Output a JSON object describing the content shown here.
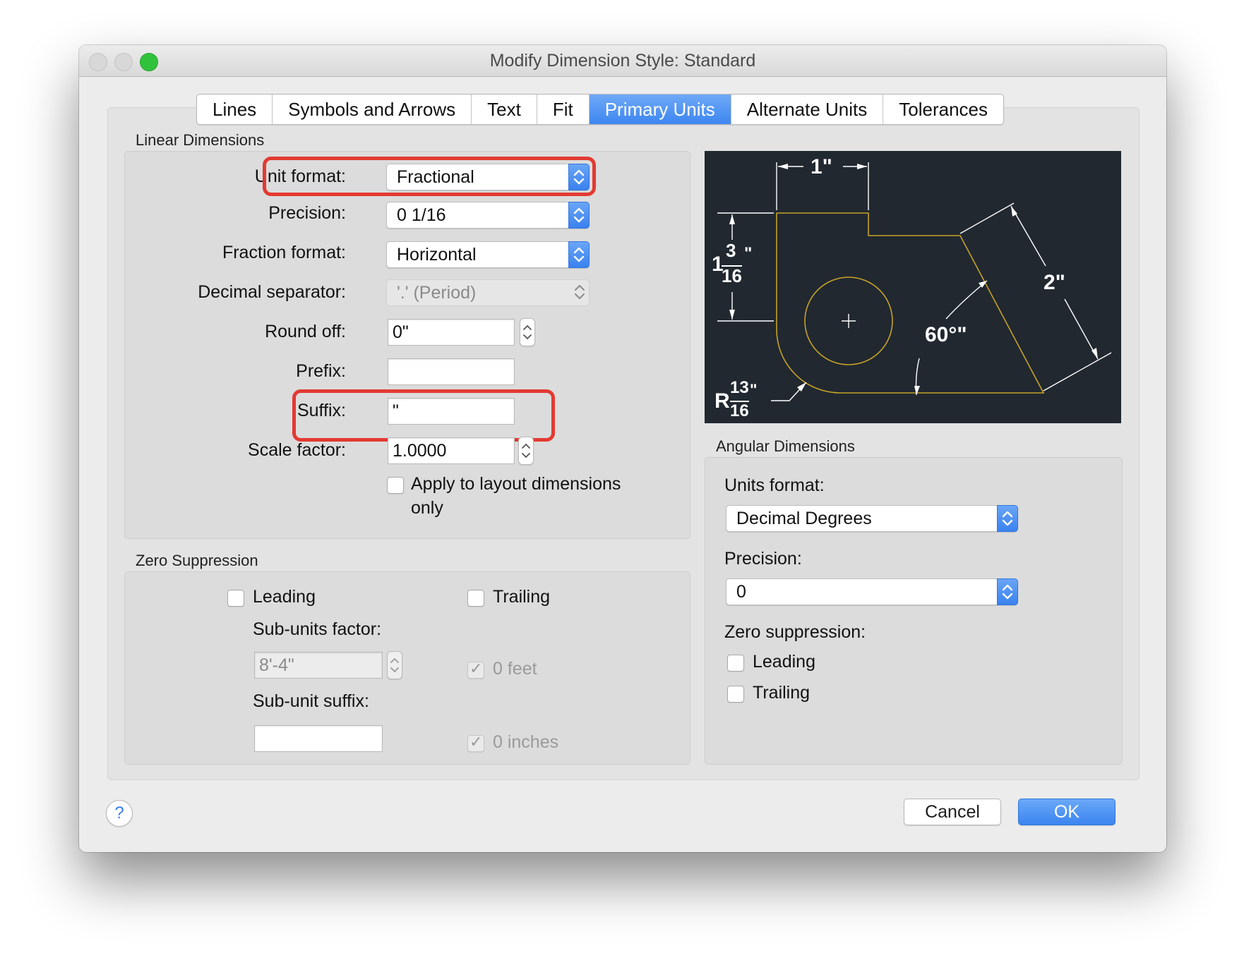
{
  "window": {
    "title": "Modify Dimension Style: Standard"
  },
  "tabs": [
    {
      "label": "Lines"
    },
    {
      "label": "Symbols and Arrows"
    },
    {
      "label": "Text"
    },
    {
      "label": "Fit"
    },
    {
      "label": "Primary Units",
      "active": true
    },
    {
      "label": "Alternate Units"
    },
    {
      "label": "Tolerances"
    }
  ],
  "linear": {
    "group_label": "Linear Dimensions",
    "unit_format_label": "Unit format:",
    "unit_format_value": "Fractional",
    "precision_label": "Precision:",
    "precision_value": "0 1/16",
    "fraction_format_label": "Fraction format:",
    "fraction_format_value": "Horizontal",
    "decimal_separator_label": "Decimal separator:",
    "decimal_separator_value": "'.' (Period)",
    "round_off_label": "Round off:",
    "round_off_value": "0\"",
    "prefix_label": "Prefix:",
    "prefix_value": "",
    "suffix_label": "Suffix:",
    "suffix_value": "\"",
    "scale_factor_label": "Scale factor:",
    "scale_factor_value": "1.0000",
    "apply_layout_line1": "Apply to layout dimensions",
    "apply_layout_line2": "only"
  },
  "zero_suppression": {
    "group_label": "Zero Suppression",
    "leading_label": "Leading",
    "trailing_label": "Trailing",
    "sub_units_factor_label": "Sub-units factor:",
    "sub_units_factor_value": "8'-4\"",
    "sub_unit_suffix_label": "Sub-unit suffix:",
    "sub_unit_suffix_value": "",
    "feet_label": "0 feet",
    "inches_label": "0 inches"
  },
  "preview": {
    "dim_top": "1\"",
    "dim_left_whole": "1",
    "dim_left_num": "3",
    "dim_left_den": "16",
    "dim_left_unit": "\"",
    "dim_right": "2\"",
    "dim_angle": "60°\"",
    "dim_radius_prefix": "R",
    "dim_radius_num": "13",
    "dim_radius_den": "16",
    "dim_radius_unit": "\"",
    "colors": {
      "background": "#212830",
      "geometry": "#c6a227",
      "dims": "#ffffff"
    }
  },
  "angular": {
    "group_label": "Angular Dimensions",
    "units_format_label": "Units format:",
    "units_format_value": "Decimal Degrees",
    "precision_label": "Precision:",
    "precision_value": "0",
    "zero_suppression_label": "Zero suppression:",
    "leading_label": "Leading",
    "trailing_label": "Trailing"
  },
  "buttons": {
    "help": "?",
    "cancel": "Cancel",
    "ok": "OK"
  }
}
